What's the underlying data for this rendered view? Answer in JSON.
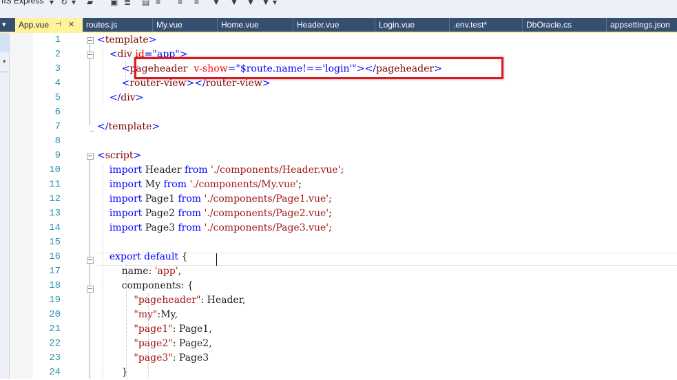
{
  "toolbar": {
    "run_target": "IIS Express"
  },
  "tabs": [
    {
      "label": "App.vue",
      "active": true
    },
    {
      "label": "routes.js"
    },
    {
      "label": "My.vue"
    },
    {
      "label": "Home.vue"
    },
    {
      "label": "Header.vue"
    },
    {
      "label": "Login.vue"
    },
    {
      "label": ".env.test*"
    },
    {
      "label": "DbOracle.cs"
    },
    {
      "label": "appsettings.json"
    }
  ],
  "line_numbers": [
    "1",
    "2",
    "3",
    "4",
    "5",
    "6",
    "7",
    "8",
    "9",
    "10",
    "11",
    "12",
    "13",
    "14",
    "15",
    "16",
    "17",
    "18",
    "19",
    "20",
    "21",
    "22",
    "23",
    "24"
  ],
  "code": [
    {
      "n": "1",
      "parts": [
        {
          "t": "<",
          "c": "#0000ff"
        },
        {
          "t": "template",
          "c": "#800000"
        },
        {
          "t": ">",
          "c": "#0000ff"
        }
      ]
    },
    {
      "n": "2",
      "parts": [
        {
          "t": "    "
        },
        {
          "t": "<",
          "c": "#0000ff"
        },
        {
          "t": "div",
          "c": "#800000"
        },
        {
          "t": " id",
          "c": "#ff0000"
        },
        {
          "t": "=",
          "c": "#0000ff"
        },
        {
          "t": "\"app\"",
          "c": "#0000ff"
        },
        {
          "t": ">",
          "c": "#0000ff"
        }
      ]
    },
    {
      "n": "3",
      "parts": [
        {
          "t": "        "
        },
        {
          "t": "<",
          "c": "#0000ff"
        },
        {
          "t": "pageheader",
          "c": "#800000"
        },
        {
          "t": "  v-show",
          "c": "#ff0000"
        },
        {
          "t": "=",
          "c": "#0000ff"
        },
        {
          "t": "\"$route.name!=='login'\"",
          "c": "#0000ff"
        },
        {
          "t": "></",
          "c": "#0000ff"
        },
        {
          "t": "pageheader",
          "c": "#800000"
        },
        {
          "t": ">",
          "c": "#0000ff"
        }
      ]
    },
    {
      "n": "4",
      "parts": [
        {
          "t": "        "
        },
        {
          "t": "<",
          "c": "#0000ff"
        },
        {
          "t": "router-view",
          "c": "#800000"
        },
        {
          "t": "></",
          "c": "#0000ff"
        },
        {
          "t": "router-view",
          "c": "#800000"
        },
        {
          "t": ">",
          "c": "#0000ff"
        }
      ]
    },
    {
      "n": "5",
      "parts": [
        {
          "t": "    "
        },
        {
          "t": "</",
          "c": "#0000ff"
        },
        {
          "t": "div",
          "c": "#800000"
        },
        {
          "t": ">",
          "c": "#0000ff"
        }
      ]
    },
    {
      "n": "6",
      "parts": []
    },
    {
      "n": "7",
      "parts": [
        {
          "t": "</",
          "c": "#0000ff"
        },
        {
          "t": "template",
          "c": "#800000"
        },
        {
          "t": ">",
          "c": "#0000ff"
        }
      ]
    },
    {
      "n": "8",
      "parts": []
    },
    {
      "n": "9",
      "parts": [
        {
          "t": "<",
          "c": "#0000ff"
        },
        {
          "t": "script",
          "c": "#800000"
        },
        {
          "t": ">",
          "c": "#0000ff"
        }
      ]
    },
    {
      "n": "10",
      "parts": [
        {
          "t": "    "
        },
        {
          "t": "import",
          "c": "#0000ff"
        },
        {
          "t": " Header "
        },
        {
          "t": "from",
          "c": "#0000ff"
        },
        {
          "t": " "
        },
        {
          "t": "'./components/Header.vue'",
          "c": "#a31515"
        },
        {
          "t": ";"
        }
      ]
    },
    {
      "n": "11",
      "parts": [
        {
          "t": "    "
        },
        {
          "t": "import",
          "c": "#0000ff"
        },
        {
          "t": " My "
        },
        {
          "t": "from",
          "c": "#0000ff"
        },
        {
          "t": " "
        },
        {
          "t": "'./components/My.vue'",
          "c": "#a31515"
        },
        {
          "t": ";"
        }
      ]
    },
    {
      "n": "12",
      "parts": [
        {
          "t": "    "
        },
        {
          "t": "import",
          "c": "#0000ff"
        },
        {
          "t": " Page1 "
        },
        {
          "t": "from",
          "c": "#0000ff"
        },
        {
          "t": " "
        },
        {
          "t": "'./components/Page1.vue'",
          "c": "#a31515"
        },
        {
          "t": ";"
        }
      ]
    },
    {
      "n": "13",
      "parts": [
        {
          "t": "    "
        },
        {
          "t": "import",
          "c": "#0000ff"
        },
        {
          "t": " Page2 "
        },
        {
          "t": "from",
          "c": "#0000ff"
        },
        {
          "t": " "
        },
        {
          "t": "'./components/Page2.vue'",
          "c": "#a31515"
        },
        {
          "t": ";"
        }
      ]
    },
    {
      "n": "14",
      "parts": [
        {
          "t": "    "
        },
        {
          "t": "import",
          "c": "#0000ff"
        },
        {
          "t": " Page3 "
        },
        {
          "t": "from",
          "c": "#0000ff"
        },
        {
          "t": " "
        },
        {
          "t": "'./components/Page3.vue'",
          "c": "#a31515"
        },
        {
          "t": ";"
        }
      ]
    },
    {
      "n": "15",
      "parts": []
    },
    {
      "n": "16",
      "parts": [
        {
          "t": "    "
        },
        {
          "t": "export",
          "c": "#0000ff"
        },
        {
          "t": " "
        },
        {
          "t": "default",
          "c": "#0000ff"
        },
        {
          "t": " {"
        }
      ]
    },
    {
      "n": "17",
      "parts": [
        {
          "t": "        name: "
        },
        {
          "t": "'app'",
          "c": "#a31515"
        },
        {
          "t": ","
        }
      ]
    },
    {
      "n": "18",
      "parts": [
        {
          "t": "        components: {"
        }
      ]
    },
    {
      "n": "19",
      "parts": [
        {
          "t": "            "
        },
        {
          "t": "\"pageheader\"",
          "c": "#a31515"
        },
        {
          "t": ": Header,"
        }
      ]
    },
    {
      "n": "20",
      "parts": [
        {
          "t": "            "
        },
        {
          "t": "\"my\"",
          "c": "#a31515"
        },
        {
          "t": ":My,"
        }
      ]
    },
    {
      "n": "21",
      "parts": [
        {
          "t": "            "
        },
        {
          "t": "\"page1\"",
          "c": "#a31515"
        },
        {
          "t": ": Page1,"
        }
      ]
    },
    {
      "n": "22",
      "parts": [
        {
          "t": "            "
        },
        {
          "t": "\"page2\"",
          "c": "#a31515"
        },
        {
          "t": ": Page2,"
        }
      ]
    },
    {
      "n": "23",
      "parts": [
        {
          "t": "            "
        },
        {
          "t": "\"page3\"",
          "c": "#a31515"
        },
        {
          "t": ": Page3"
        }
      ]
    },
    {
      "n": "24",
      "parts": [
        {
          "t": "        }"
        }
      ]
    }
  ]
}
